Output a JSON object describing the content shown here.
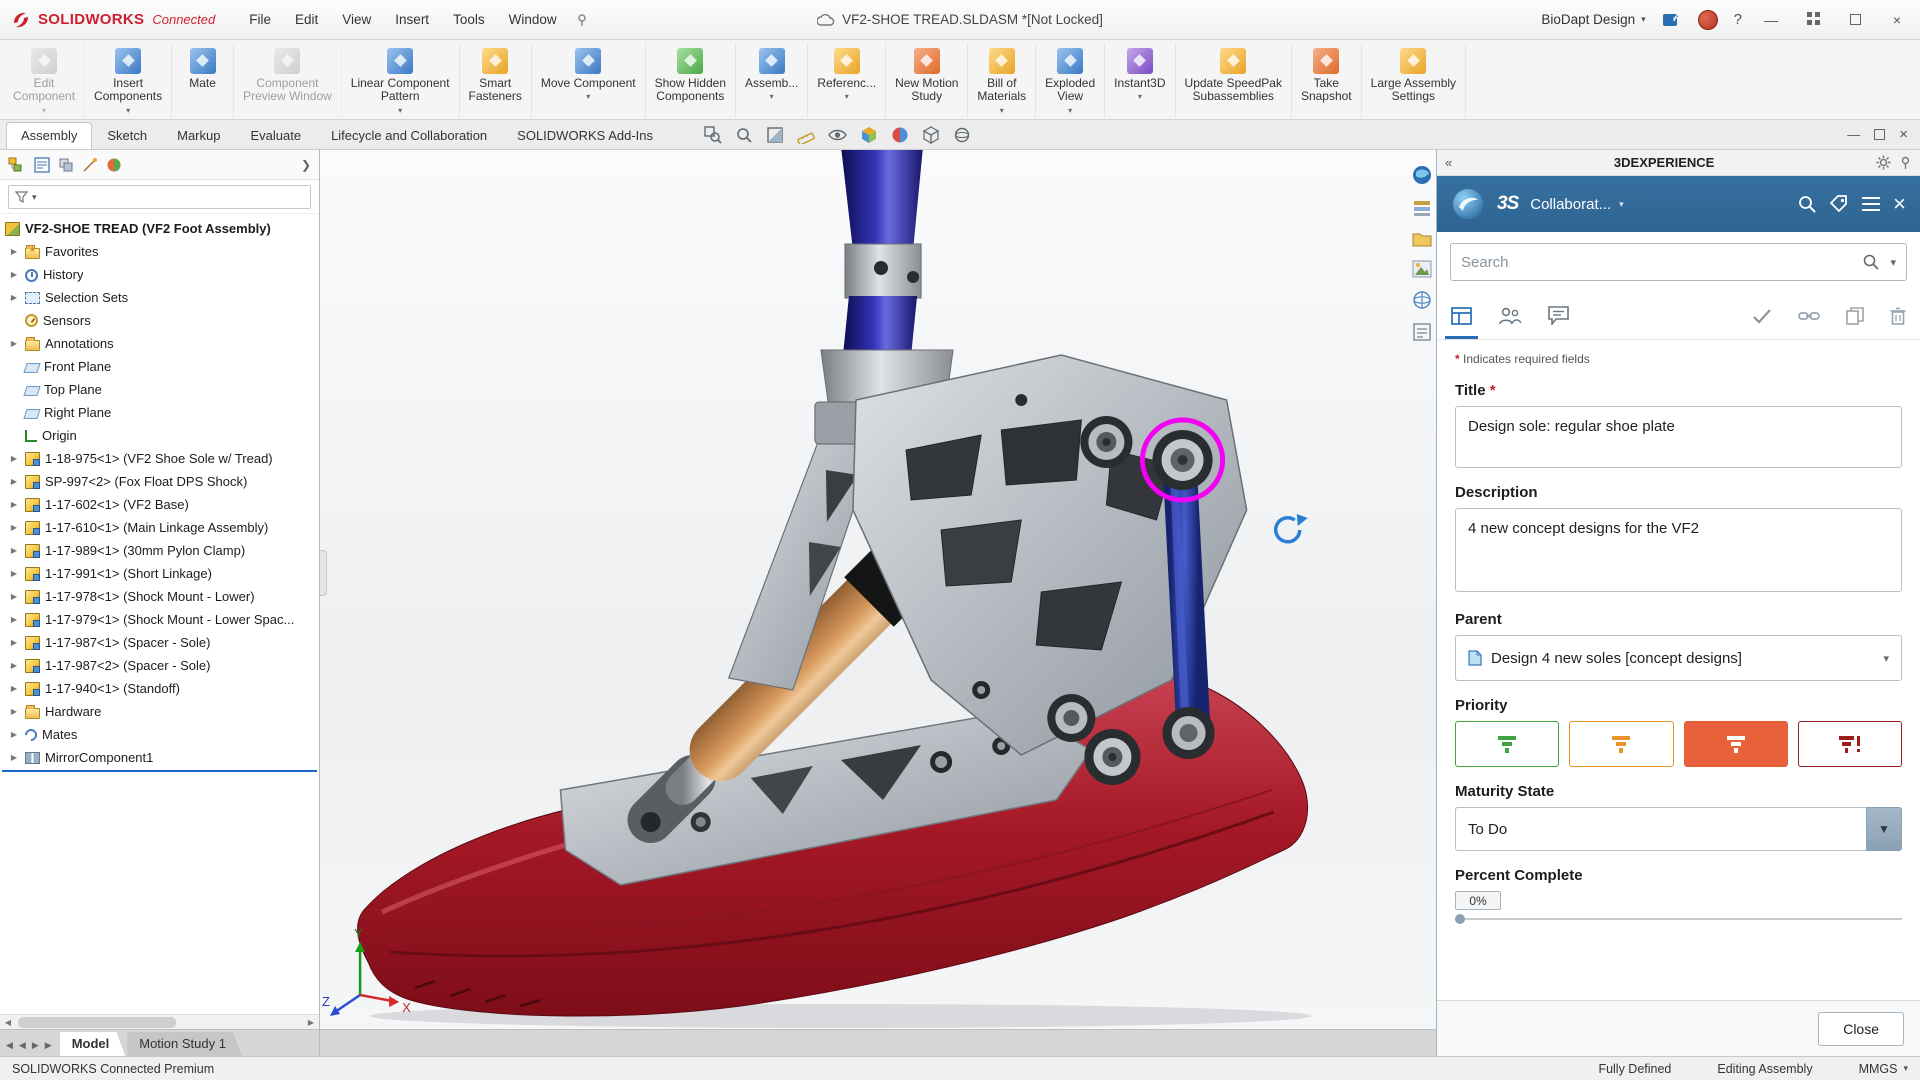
{
  "colors": {
    "solidworks_red": "#cf1f2f",
    "panel_blue": "#30679a",
    "accent_blue": "#2a6fb4",
    "priority_green": "#3da53d",
    "priority_orange": "#e8922a",
    "priority_selected_fill": "#e8613a",
    "priority_dark_red": "#9e1b1b",
    "highlight_magenta": "#ff00ff",
    "sole_red": "#a51826",
    "pylon_blue": "#2a2a9e",
    "shock_bronze": "#c08a50"
  },
  "titlebar": {
    "logo_text": "SOLIDWORKS",
    "logo_suffix": "Connected",
    "menus": [
      {
        "label": "File"
      },
      {
        "label": "Edit"
      },
      {
        "label": "View"
      },
      {
        "label": "Insert"
      },
      {
        "label": "Tools"
      },
      {
        "label": "Window"
      }
    ],
    "doc_title": "VF2-SHOE TREAD.SLDASM *[Not Locked]",
    "workspace": "BioDapt Design",
    "help_label": "?"
  },
  "ribbon": {
    "buttons": [
      {
        "label": "Edit\nComponent",
        "tint": "t7",
        "caret": "on",
        "state": "disabled"
      },
      {
        "label": "Insert\nComponents",
        "tint": "t3",
        "caret": "on",
        "state": ""
      },
      {
        "label": "Mate",
        "tint": "t3",
        "caret": "off",
        "state": ""
      },
      {
        "label": "Component\nPreview Window",
        "tint": "t7",
        "caret": "off",
        "state": "disabled"
      },
      {
        "label": "Linear Component\nPattern",
        "tint": "t3",
        "caret": "on",
        "state": ""
      },
      {
        "label": "Smart\nFasteners",
        "tint": "t2",
        "caret": "off",
        "state": ""
      },
      {
        "label": "Move Component",
        "tint": "t3",
        "caret": "on",
        "state": ""
      },
      {
        "label": "Show Hidden\nComponents",
        "tint": "t5",
        "caret": "off",
        "state": ""
      },
      {
        "label": "Assemb...",
        "tint": "t3",
        "caret": "on",
        "state": ""
      },
      {
        "label": "Referenc...",
        "tint": "t2",
        "caret": "on",
        "state": ""
      },
      {
        "label": "New Motion\nStudy",
        "tint": "t6",
        "caret": "off",
        "state": ""
      },
      {
        "label": "Bill of\nMaterials",
        "tint": "t2",
        "caret": "on",
        "state": ""
      },
      {
        "label": "Exploded\nView",
        "tint": "t3",
        "caret": "on",
        "state": ""
      },
      {
        "label": "Instant3D",
        "tint": "t4",
        "caret": "on",
        "state": ""
      },
      {
        "label": "Update SpeedPak\nSubassemblies",
        "tint": "t2",
        "caret": "off",
        "state": ""
      },
      {
        "label": "Take\nSnapshot",
        "tint": "t6",
        "caret": "off",
        "state": ""
      },
      {
        "label": "Large Assembly\nSettings",
        "tint": "t2",
        "caret": "off",
        "state": ""
      }
    ]
  },
  "tabbar": {
    "tabs": [
      {
        "label": "Assembly",
        "state": "active"
      },
      {
        "label": "Sketch",
        "state": ""
      },
      {
        "label": "Markup",
        "state": ""
      },
      {
        "label": "Evaluate",
        "state": ""
      },
      {
        "label": "Lifecycle and Collaboration",
        "state": ""
      },
      {
        "label": "SOLIDWORKS Add-Ins",
        "state": ""
      }
    ],
    "hud_icons": [
      "zoom-to-area",
      "zoom-fit",
      "section-view",
      "measure",
      "hide-show-items",
      "view-orientation",
      "appearances",
      "display-style",
      "view-settings"
    ]
  },
  "tree": {
    "root": "VF2-SHOE TREAD (VF2 Foot Assembly)",
    "items": [
      {
        "label": "Favorites",
        "icon": "tic-folder is-star",
        "arrow": "on"
      },
      {
        "label": "History",
        "icon": "tic-clock",
        "arrow": "on"
      },
      {
        "label": "Selection Sets",
        "icon": "tic-sel",
        "arrow": "on"
      },
      {
        "label": "Sensors",
        "icon": "tic-sensor",
        "arrow": "off"
      },
      {
        "label": "Annotations",
        "icon": "tic-folder",
        "arrow": "on"
      },
      {
        "label": "Front Plane",
        "icon": "tic-plane",
        "arrow": "off"
      },
      {
        "label": "Top Plane",
        "icon": "tic-plane",
        "arrow": "off"
      },
      {
        "label": "Right Plane",
        "icon": "tic-plane",
        "arrow": "off"
      },
      {
        "label": "Origin",
        "icon": "tic-origin",
        "arrow": "off"
      },
      {
        "label": "1-18-975<1> (VF2 Shoe Sole w/ Tread)",
        "icon": "tic-comp",
        "arrow": "on"
      },
      {
        "label": "SP-997<2> (Fox Float DPS Shock)",
        "icon": "tic-comp",
        "arrow": "on"
      },
      {
        "label": "1-17-602<1> (VF2 Base)",
        "icon": "tic-comp",
        "arrow": "on"
      },
      {
        "label": "1-17-610<1> (Main Linkage Assembly)",
        "icon": "tic-comp",
        "arrow": "on"
      },
      {
        "label": "1-17-989<1> (30mm Pylon Clamp)",
        "icon": "tic-comp",
        "arrow": "on"
      },
      {
        "label": "1-17-991<1> (Short Linkage)",
        "icon": "tic-comp",
        "arrow": "on"
      },
      {
        "label": "1-17-978<1> (Shock Mount - Lower)",
        "icon": "tic-comp",
        "arrow": "on"
      },
      {
        "label": "1-17-979<1> (Shock Mount - Lower Spac...",
        "icon": "tic-comp",
        "arrow": "on"
      },
      {
        "label": "1-17-987<1> (Spacer - Sole)",
        "icon": "tic-comp",
        "arrow": "on"
      },
      {
        "label": "1-17-987<2> (Spacer - Sole)",
        "icon": "tic-comp",
        "arrow": "on"
      },
      {
        "label": "1-17-940<1> (Standoff)",
        "icon": "tic-comp",
        "arrow": "on"
      },
      {
        "label": "Hardware",
        "icon": "tic-folder",
        "arrow": "on"
      },
      {
        "label": "Mates",
        "icon": "tic-mates",
        "arrow": "on"
      },
      {
        "label": "MirrorComponent1",
        "icon": "tic-mirror",
        "arrow": "on"
      }
    ]
  },
  "viewport": {
    "side_icons": [
      "experience-sphere",
      "design-library",
      "file-explorer",
      "view-palette",
      "appearances-scenes",
      "custom-properties"
    ],
    "triad": {
      "x": "X",
      "y": "Y",
      "z": "Z"
    }
  },
  "model_tabs": {
    "tabs": [
      {
        "label": "Model",
        "state": "active"
      },
      {
        "label": "Motion Study 1",
        "state": ""
      }
    ]
  },
  "panel": {
    "header": "3DEXPERIENCE",
    "brand": "3S",
    "app_name": "Collaborat...",
    "search_placeholder": "Search",
    "tab_icons": [
      "details",
      "people",
      "comments",
      "approve",
      "link",
      "duplicate",
      "delete"
    ],
    "required_star": "*",
    "required_note": "Indicates required fields",
    "fields": {
      "title_label": "Title",
      "title_value": "Design sole: regular shoe plate",
      "description_label": "Description",
      "description_value": "4 new concept designs for the VF2",
      "parent_label": "Parent",
      "parent_value": "Design 4 new soles [concept designs]",
      "priority_label": "Priority",
      "maturity_label": "Maturity State",
      "maturity_value": "To Do",
      "percent_label": "Percent Complete",
      "percent_value": "0%"
    },
    "close_label": "Close"
  },
  "statusbar": {
    "left": "SOLIDWORKS Connected Premium",
    "items": [
      {
        "label": "Fully Defined"
      },
      {
        "label": "Editing Assembly"
      },
      {
        "label": "MMGS"
      }
    ]
  }
}
